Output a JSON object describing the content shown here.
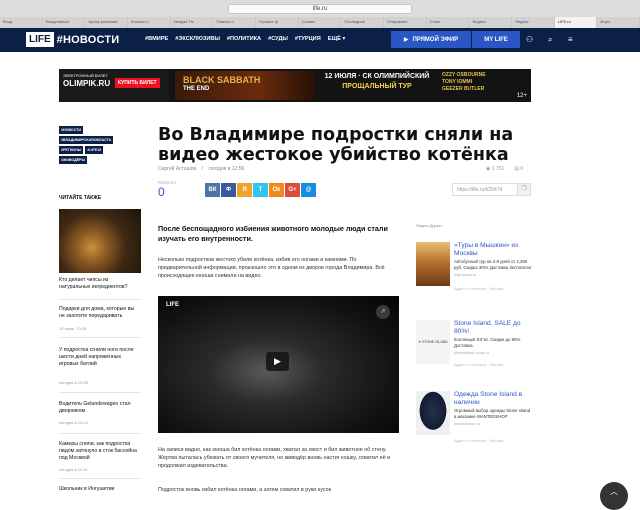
{
  "browser": {
    "url": "life.ru",
    "tabs": [
      "Вход",
      "Ежедневные",
      "Центр решения",
      "Блокнот с",
      "Ниндзя Тю",
      "Памяти о",
      "Лучшие ф",
      "Ставки",
      "Последние",
      "Отправлен",
      "О нас",
      "Яндекс",
      "Яндекс",
      "LIFE.ru",
      "Игры"
    ]
  },
  "header": {
    "logo_box": "LIFE",
    "logo_text": "#НОВОСТИ",
    "nav": [
      "#ВМИРЕ",
      "#ЭКСКЛЮЗИВЫ",
      "#ПОЛИТИКА",
      "#СУДЫ",
      "#ТУРЦИЯ",
      "ЕЩЁ"
    ],
    "live_button": "ПРЯМОЙ ЭФИР",
    "mylife_button": "MY LIFE"
  },
  "banner": {
    "ticket": "ЭЛЕКТРОННЫЙ БИЛЕТ",
    "site": "OLIMPIK.RU",
    "buy": "КУПИТЬ БИЛЕТ",
    "band": "BLACK SABBATH",
    "band_sub": "THE END",
    "date_line": "12 ИЮЛЯ · СК ОЛИМПИЙСКИЙ",
    "tour": "ПРОЩАЛЬНЫЙ ТУР",
    "names": [
      "OZZY OSBOURNE",
      "TONY IOMMI",
      "GEEZER BUTLER"
    ],
    "age": "12+"
  },
  "tags": [
    "#НОВОСТИ",
    "#ВЛАДИМИРСКАЯОБЛАСТЬ",
    "#РЕГИОНЫ",
    "#LIFE10",
    "#ЖИВОДЁРЫ"
  ],
  "sidebar": {
    "heading": "ЧИТАЙТЕ ТАКЖЕ",
    "items": [
      {
        "title": "Кто делает чипсы из натуральных ингредиентов?",
        "meta": ""
      },
      {
        "title": "Подарки для дома, которые вы не захотите передаривать",
        "meta": "15 июня, 13:28"
      },
      {
        "title": "У подростка сгнили ноги после шести дней напряжённых игровых батлий",
        "meta": "сегодня в 12:59"
      },
      {
        "title": "Водитель Gelandewagen стал дворником",
        "meta": "сегодня в 12:14"
      },
      {
        "title": "Камеры сняли, как подростка пидом затянуло в сток бассейна под Москвой",
        "meta": "сегодня в 11:11"
      },
      {
        "title": "Школьник в Ингушетии",
        "meta": ""
      }
    ]
  },
  "article": {
    "title": "Во Владимире подростки сняли на видео жестокое убийство котёнка",
    "author": "Сергей Асташов",
    "date": "сегодня в 12:56",
    "views": "1 751",
    "comments": "0",
    "reposts_label": "РЕПОСТЫ",
    "reposts": "0",
    "share_buttons": [
      "ВК",
      "Ф",
      "Я",
      "Т",
      "Ok",
      "G+",
      "@"
    ],
    "short_url": "https://life.ru/t/25474",
    "lead": "После беспощадного избиения животного молодые люди стали изучать его внутренности.",
    "p1": "Несколько подростков жестоко убили котёнка, избив его ногами и камнями. По предварительной информации, произошло это в одном из дворов города Владимира. Всё происходящее юноши снимали на видео.",
    "p2": "На записи видно, как юноша бил котёнка ногами, хватал за хвост и бил животное об стену. Жертва пыталась убежать от своего мучителя, но живодёр вновь настиг кошку, схватил её и продолжил издевательства.",
    "p3": "Подросток вновь избил котёнка ногами, а затем схватил в руки кусок",
    "video_logo": "LIFE"
  },
  "direct": {
    "title": "Яндекс.Директ",
    "ads": [
      {
        "title": "«Туры в Мышкин» из Москвы",
        "desc": "Автобусный тур на 2-8 дней от 4,290 руб. Скидка 30%! Доставка бесплатно!",
        "site": "bigmskow.ru",
        "foot": "Адрес и телефон · Москва"
      },
      {
        "title": "Stone Island. SALE до 80%!",
        "desc": "Коллекция SS'16. Скидки до 80%. Доставка.",
        "site": "stoneisland-shop.ru",
        "foot": "Адрес и телефон · Москва"
      },
      {
        "title": "Одежда Stone Island в наличии",
        "desc": "Огромный выбор одежды Stone Island в магазине WANTEDSHOP",
        "site": "wantedshop.ru",
        "foot": "Адрес и телефон · Москва"
      }
    ]
  },
  "colors": {
    "header": "#0c2047",
    "accent": "#2b57c6"
  }
}
